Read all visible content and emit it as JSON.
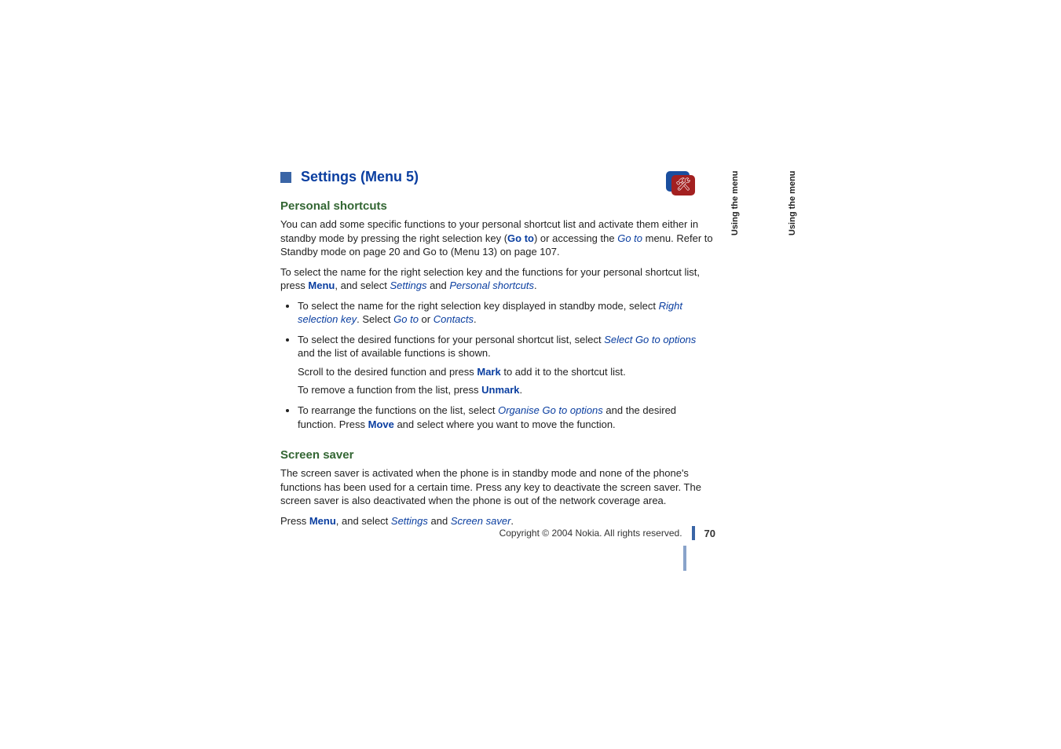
{
  "heading": {
    "title": "Settings (Menu 5)"
  },
  "side_label": "Using the menu",
  "sections": {
    "shortcuts": {
      "title": "Personal shortcuts",
      "p1_a": "You can add some specific functions to your personal shortcut list and activate them either in standby mode by pressing the right selection key (",
      "p1_goto": "Go to",
      "p1_b": ") or accessing the ",
      "p1_goto_italic": "Go to",
      "p1_c": " menu. Refer to Standby mode on page 20 and Go to (Menu 13) on page 107.",
      "p2_a": "To select the name for the right selection key and the functions for your personal shortcut list, press ",
      "p2_menu": "Menu",
      "p2_b": ", and select ",
      "p2_settings": "Settings",
      "p2_and": " and ",
      "p2_personal": "Personal shortcuts",
      "p2_end": ".",
      "li1_a": "To select the name for the right selection key displayed in standby mode, select ",
      "li1_rsk": "Right selection key",
      "li1_b": ". Select ",
      "li1_goto": "Go to",
      "li1_or": " or ",
      "li1_contacts": "Contacts",
      "li1_end": ".",
      "li2_a": "To select the desired functions for your personal shortcut list, select ",
      "li2_select": "Select Go to options",
      "li2_b": " and the list of available functions is shown.",
      "li2_sub1_a": "Scroll to the desired function and press ",
      "li2_sub1_mark": "Mark",
      "li2_sub1_b": " to add it to the shortcut list.",
      "li2_sub2_a": "To remove a function from the list, press ",
      "li2_sub2_unmark": "Unmark",
      "li2_sub2_end": ".",
      "li3_a": "To rearrange the functions on the list, select ",
      "li3_organise": "Organise Go to options",
      "li3_b": " and the desired function. Press ",
      "li3_move": "Move",
      "li3_c": " and select where you want to move the function."
    },
    "screensaver": {
      "title": "Screen saver",
      "p1": "The screen saver is activated when the phone is in standby mode and none of the phone's functions has been used for a certain time. Press any key to deactivate the screen saver. The screen saver is also deactivated when the phone is out of the network coverage area.",
      "p2_a": "Press ",
      "p2_menu": "Menu",
      "p2_b": ", and select ",
      "p2_settings": "Settings",
      "p2_and": " and ",
      "p2_ss": "Screen saver",
      "p2_end": "."
    }
  },
  "footer": {
    "copyright": "Copyright © 2004 Nokia. All rights reserved.",
    "page": "70"
  }
}
